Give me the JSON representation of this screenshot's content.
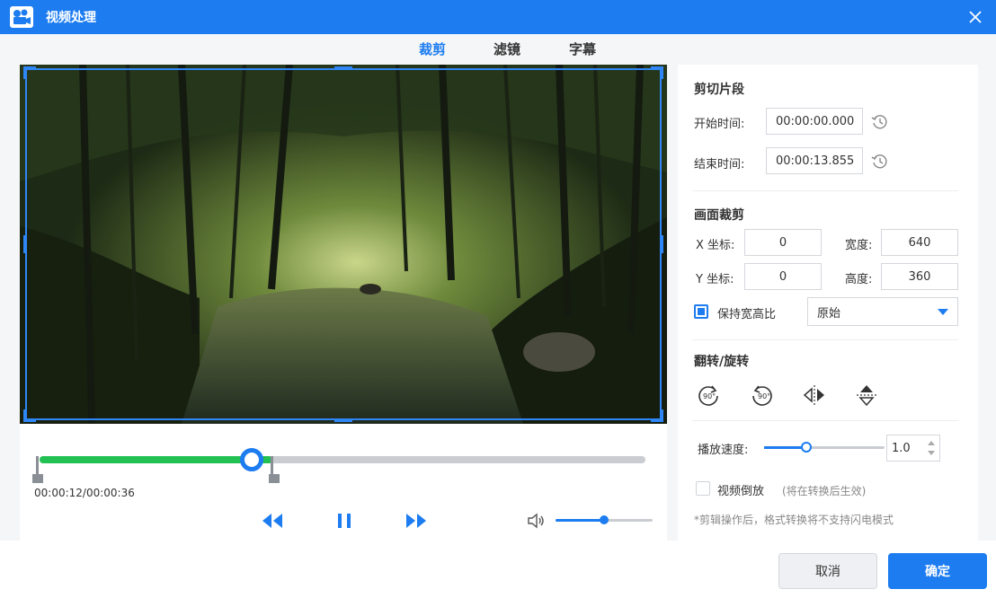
{
  "window": {
    "title": "视频处理",
    "icon": "video-clapper-icon"
  },
  "tabs": [
    {
      "label": "裁剪",
      "active": true
    },
    {
      "label": "滤镜",
      "active": false
    },
    {
      "label": "字幕",
      "active": false
    }
  ],
  "player": {
    "time_display": "00:00:12/00:00:36",
    "progress_fraction": 0.35,
    "trim_start_fraction": 0.0,
    "trim_end_fraction": 0.385,
    "volume_fraction": 0.5
  },
  "trim": {
    "title": "剪切片段",
    "start_label": "开始时间:",
    "start_value": "00:00:00.000",
    "end_label": "结束时间:",
    "end_value": "00:00:13.855"
  },
  "crop": {
    "title": "画面裁剪",
    "x_label": "X 坐标:",
    "x_value": "0",
    "y_label": "Y 坐标:",
    "y_value": "0",
    "width_label": "宽度:",
    "width_value": "640",
    "height_label": "高度:",
    "height_value": "360",
    "keep_ratio_label": "保持宽高比",
    "keep_ratio_checked": true,
    "ratio_selected": "原始"
  },
  "transform": {
    "title": "翻转/旋转"
  },
  "speed": {
    "label": "播放速度:",
    "value": "1.0",
    "level_fraction": 0.35
  },
  "reverse": {
    "label": "视频倒放",
    "hint": "(将在转换后生效)",
    "checked": false
  },
  "note": "*剪辑操作后，格式转换将不支持闪电模式",
  "buttons": {
    "cancel": "取消",
    "confirm": "确定"
  },
  "colors": {
    "accent": "#1c7cf0",
    "progress_green": "#23c153"
  }
}
